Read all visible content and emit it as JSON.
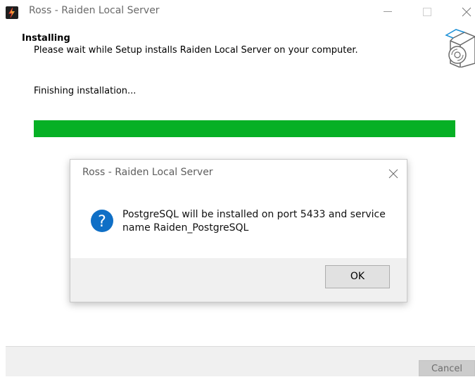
{
  "window": {
    "title": "Ross - Raiden Local Server"
  },
  "header": {
    "section_title": "Installing",
    "section_subtitle": "Please wait while Setup installs Raiden Local Server on your computer."
  },
  "main": {
    "status_text": "Finishing installation...",
    "progress_fraction": 1.0,
    "progress_color": "#06b025"
  },
  "footer": {
    "cancel_label": "Cancel"
  },
  "dialog": {
    "title": "Ross - Raiden Local Server",
    "icon": "question-icon",
    "message": "PostgreSQL will be installed on port 5433 and service name Raiden_PostgreSQL",
    "ok_label": "OK",
    "icon_color": "#0f6fc6"
  }
}
